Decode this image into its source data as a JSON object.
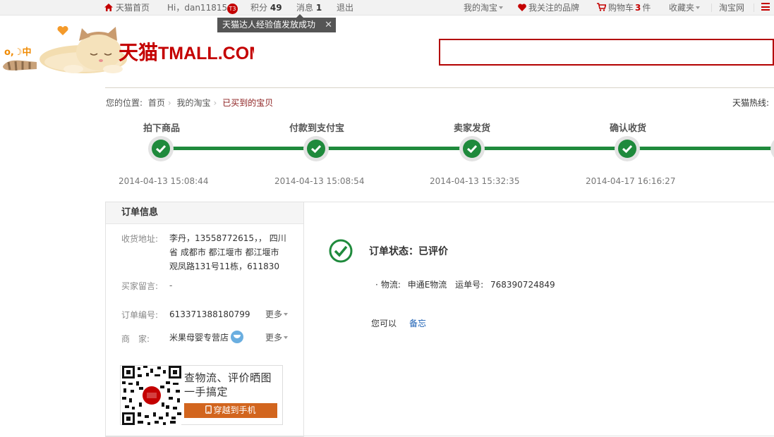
{
  "topbar": {
    "home": "天猫首页",
    "greeting": "Hi，",
    "username": "dan11815",
    "level_badge": "T3",
    "points_label": "积分",
    "points_value": "49",
    "messages_label": "消息",
    "messages_value": "1",
    "logout": "退出",
    "my_taobao": "我的淘宝",
    "brands": "我关注的品牌",
    "cart_label": "购物车",
    "cart_count": "3",
    "cart_unit": "件",
    "favorites": "收藏夹",
    "taobao": "淘宝网",
    "accent_color": "#c40000"
  },
  "tooltip": {
    "text": "天猫达人经验值发放成功",
    "close": "✕"
  },
  "logo": {
    "brand_cn": "天猫",
    "brand_en": "TMALL.COM",
    "badge_text": "o,☽中"
  },
  "breadcrumb": {
    "prefix": "您的位置:",
    "items": [
      "首页",
      "我的淘宝",
      "已买到的宝贝"
    ],
    "hotline": "天猫热线:"
  },
  "progress": {
    "color": "#1f8a3c",
    "steps": [
      {
        "label": "拍下商品",
        "time": "2014-04-13 15:08:44"
      },
      {
        "label": "付款到支付宝",
        "time": "2014-04-13 15:08:54"
      },
      {
        "label": "卖家发货",
        "time": "2014-04-13 15:32:35"
      },
      {
        "label": "确认收货",
        "time": "2014-04-17 16:16:27"
      }
    ]
  },
  "order_info": {
    "title": "订单信息",
    "address_label": "收货地址:",
    "address_lines": [
      "李丹，13558772615，， 四川",
      "省 成都市 都江堰市 都江堰市",
      "观凤路131号11栋，611830"
    ],
    "message_label": "买家留言:",
    "message_value": "-",
    "order_no_label": "订单编号:",
    "order_no": "613371388180799",
    "more": "更多",
    "seller_label": "商　家:",
    "seller": "米果母婴专营店",
    "qr_text_line1": "查物流、评价晒图",
    "qr_text_line2": "一手搞定",
    "qr_button": "穿越到手机"
  },
  "status": {
    "label": "订单状态：",
    "value": "已评价",
    "logistics_dot": "·",
    "logistics_label": "物流:",
    "carrier": "申通E物流",
    "waybill_label": "运单号:",
    "waybill": "768390724849",
    "can_do": "您可以",
    "memo": "备忘"
  }
}
